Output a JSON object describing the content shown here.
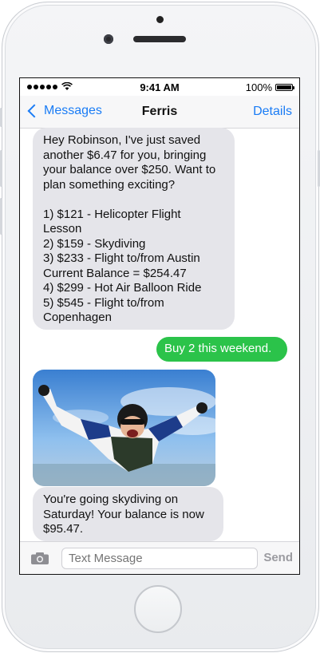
{
  "status_bar": {
    "signal_dots": 5,
    "time": "9:41 AM",
    "battery": "100%"
  },
  "nav": {
    "back_label": "Messages",
    "title": "Ferris",
    "details_label": "Details"
  },
  "messages": [
    {
      "direction": "received",
      "text": "Hey Robinson, I've just saved\nanother $6.47 for you, bringing\nyour balance over $250. Want to\nplan something exciting?\n\n1) $121 - Helicopter Flight\nLesson\n2) $159 - Skydiving\n3) $233 - Flight to/from Austin\nCurrent Balance = $254.47\n4) $299 - Hot Air Balloon Ride\n5) $545 - Flight to/from\nCopenhagen"
    },
    {
      "direction": "sent",
      "text": "Buy 2 this weekend."
    },
    {
      "direction": "received",
      "type": "image",
      "image": "skydiver-photo"
    },
    {
      "direction": "received",
      "text": "You're going skydiving on\nSaturday! Your balance is now\n$95.47."
    }
  ],
  "composer": {
    "placeholder": "Text Message",
    "send_label": "Send"
  },
  "colors": {
    "accent_blue": "#1a7cf5",
    "sent_bubble": "#2bc34a",
    "received_bubble": "#e5e5ea"
  }
}
